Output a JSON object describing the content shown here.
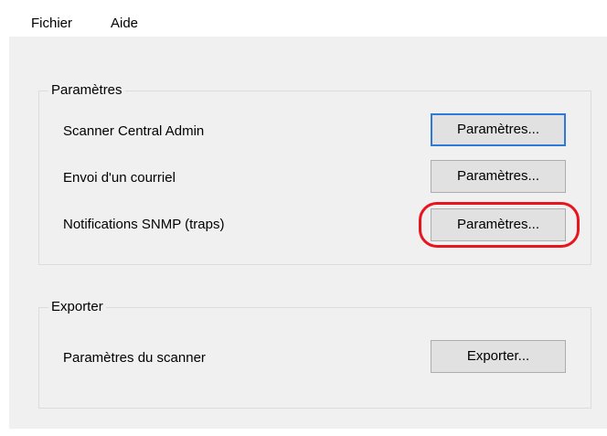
{
  "menu": {
    "items": [
      "Fichier",
      "Aide"
    ]
  },
  "settings_group": {
    "title": "Paramètres",
    "rows": [
      {
        "label": "Scanner Central Admin",
        "button": "Paramètres..."
      },
      {
        "label": "Envoi d'un courriel",
        "button": "Paramètres..."
      },
      {
        "label": "Notifications SNMP (traps)",
        "button": "Paramètres..."
      }
    ]
  },
  "export_group": {
    "title": "Exporter",
    "rows": [
      {
        "label": "Paramètres du scanner",
        "button": "Exporter..."
      }
    ]
  },
  "colors": {
    "focus_border": "#2f7ad6",
    "highlight": "#e8141e",
    "window_bg": "#f0f0f0",
    "button_bg": "#e1e1e1"
  }
}
